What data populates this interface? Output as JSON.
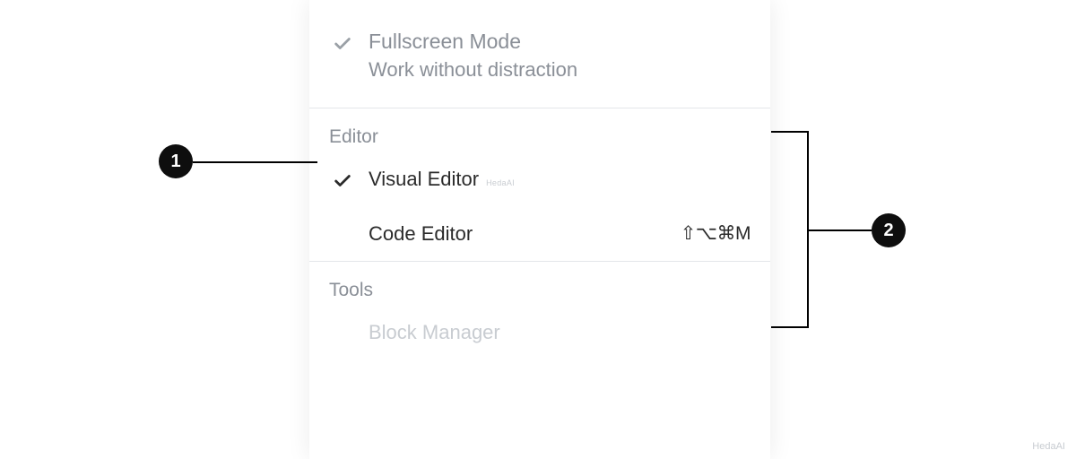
{
  "menu": {
    "fullscreen": {
      "title": "Fullscreen Mode",
      "description": "Work without distraction"
    },
    "editor": {
      "heading": "Editor",
      "visual": "Visual Editor",
      "code": "Code Editor",
      "code_shortcut": "⇧⌥⌘M"
    },
    "tools": {
      "heading": "Tools",
      "block_manager": "Block Manager"
    }
  },
  "annotations": {
    "label_1": "1",
    "label_2": "2"
  },
  "watermark": "HedaAI"
}
